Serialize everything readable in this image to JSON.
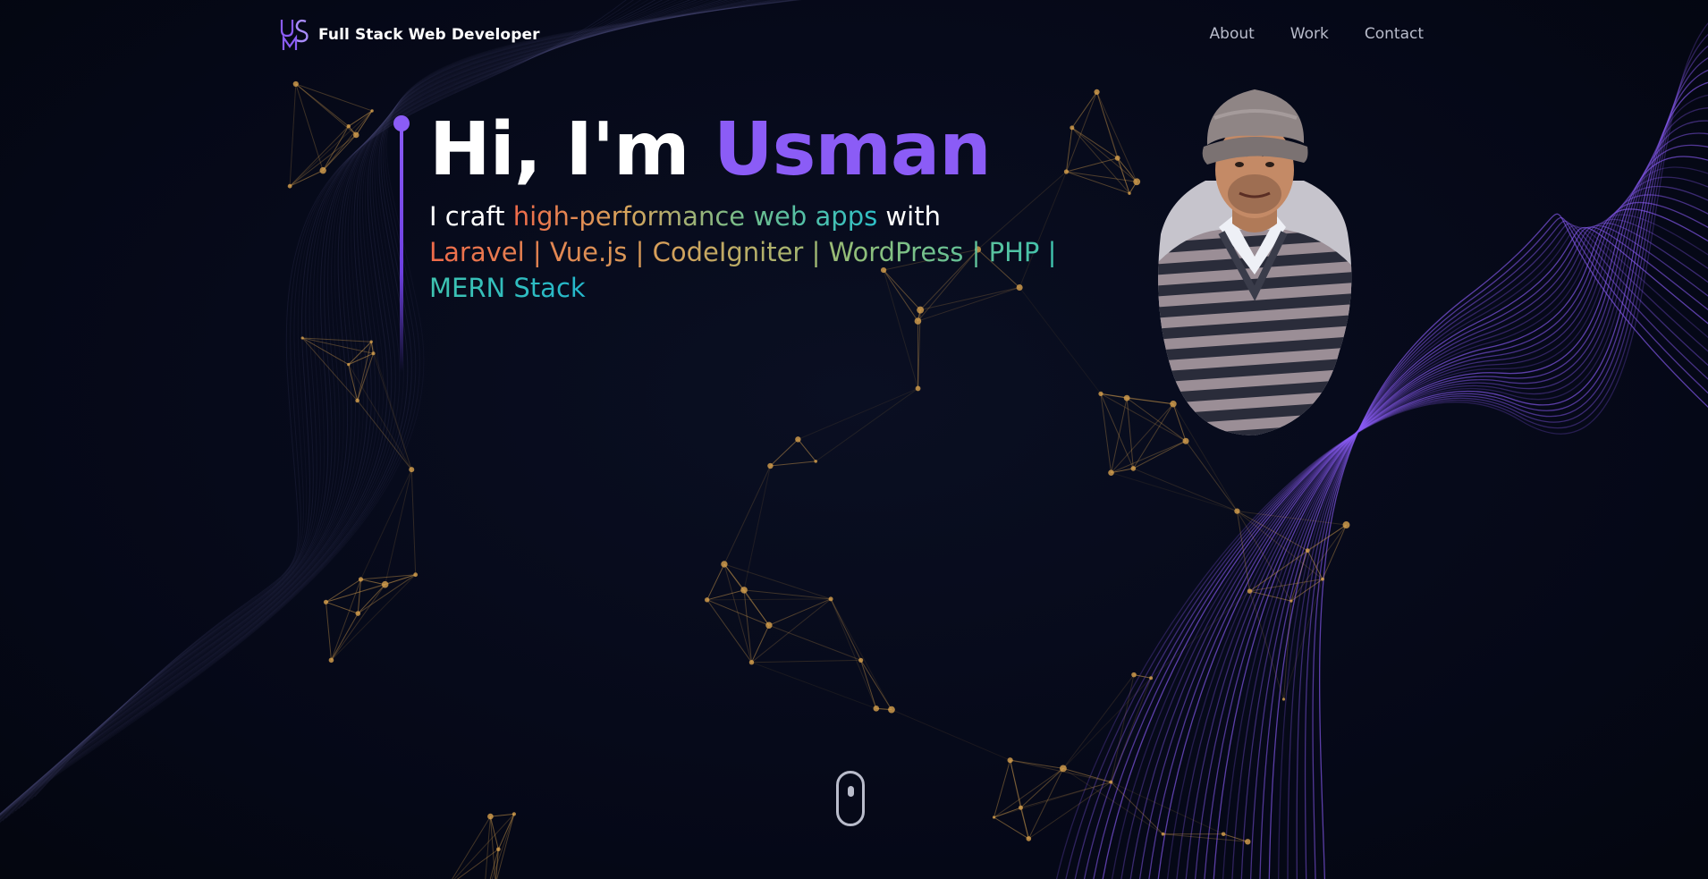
{
  "brand": {
    "logo_text": "USM",
    "title": "Full Stack Web Developer"
  },
  "nav": {
    "items": [
      "About",
      "Work",
      "Contact"
    ]
  },
  "hero": {
    "greeting": "Hi, I'm ",
    "name": "Usman",
    "sub_prefix": "I craft ",
    "sub_highlight": "high-performance web apps",
    "sub_suffix": " with",
    "stack": "Laravel | Vue.js | CodeIgniter | WordPress | PHP | MERN Stack"
  },
  "portrait": {
    "icon": "profile-photo"
  },
  "scroll": {
    "icon": "mouse-scroll-icon"
  },
  "colors": {
    "background": "#060a18",
    "accent": "#8b5cf6",
    "network": "#d8a14e",
    "nav_text": "#b9bccb"
  }
}
